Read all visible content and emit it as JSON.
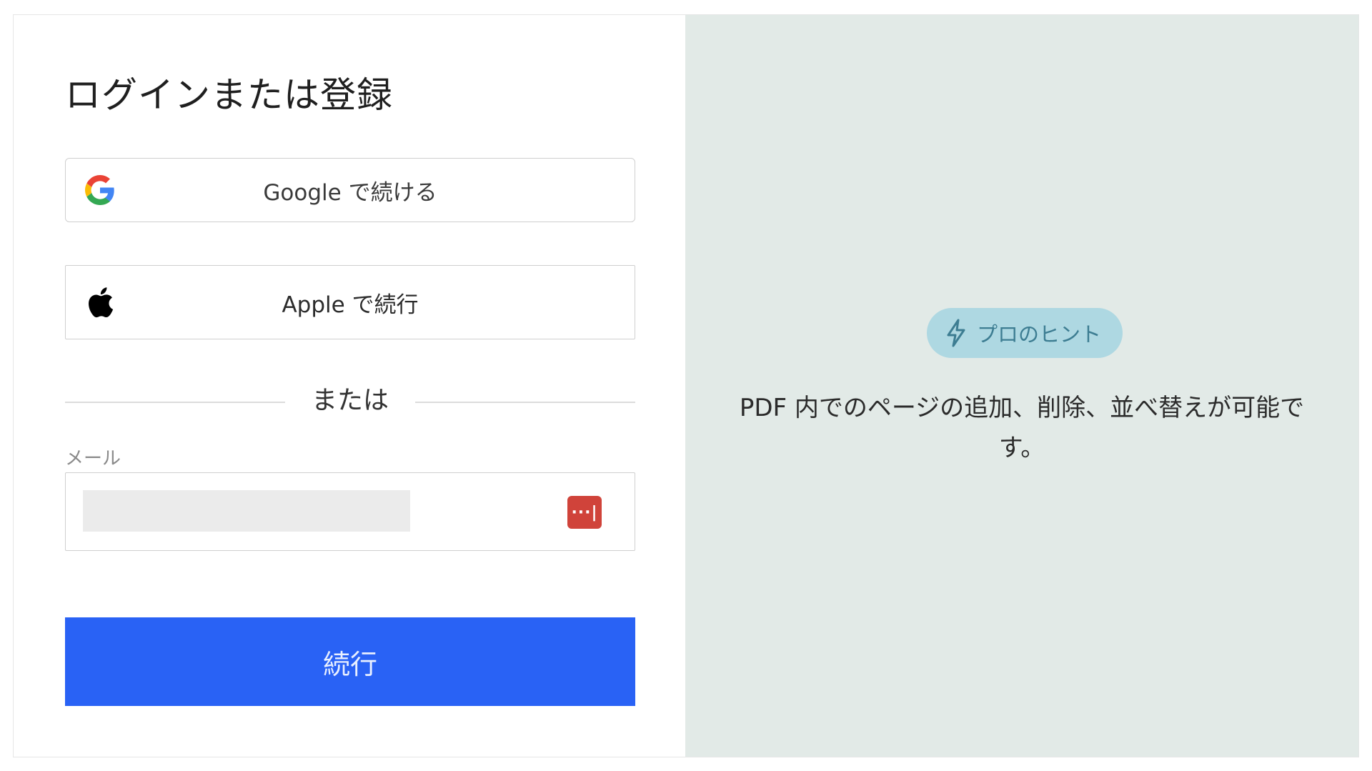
{
  "login": {
    "title": "ログインまたは登録",
    "google_button": "Google で続ける",
    "apple_button": "Apple で続行",
    "divider_text": "または",
    "email_label": "メール",
    "email_value": "",
    "password_manager_icon": "···|",
    "continue_button": "続行"
  },
  "tip": {
    "badge_label": "プロのヒント",
    "text": "PDF 内でのページの追加、削除、並べ替えが可能です。"
  },
  "colors": {
    "primary_button": "#2962f5",
    "right_panel_bg": "#e2eae7",
    "badge_bg": "#aed8e2",
    "password_icon_bg": "#d0433a"
  },
  "icons": {
    "google": "google-logo-icon",
    "apple": "apple-logo-icon",
    "bolt": "lightning-bolt-icon",
    "password_manager": "password-manager-icon"
  }
}
